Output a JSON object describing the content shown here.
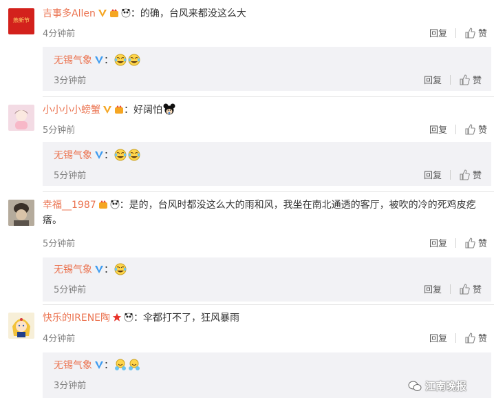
{
  "comments": [
    {
      "user": "吉事多Allen",
      "text": "：的确，台风来都没这么大",
      "time": "4分钟前",
      "reply_label": "回复",
      "like_label": "赞",
      "reply": {
        "user": "无锡气象",
        "text": "：",
        "time": "3分钟前",
        "reply_label": "回复",
        "like_label": "赞",
        "emojis": [
          "laugh-cry-emoji",
          "laugh-cry-emoji"
        ]
      }
    },
    {
      "user": "小小小小螃蟹",
      "text": "：好阔怕",
      "time": "5分钟前",
      "reply_label": "回复",
      "like_label": "赞",
      "reply": {
        "user": "无锡气象",
        "text": "：",
        "time": "5分钟前",
        "reply_label": "回复",
        "like_label": "赞",
        "emojis": [
          "laugh-cry-emoji",
          "laugh-cry-emoji"
        ]
      }
    },
    {
      "user": "幸福__1987",
      "text": "：是的，台风时都没这么大的雨和风，我坐在南北通透的客厅，被吹的冷的死鸡皮疙瘩。",
      "time": "5分钟前",
      "reply_label": "回复",
      "like_label": "赞",
      "reply": {
        "user": "无锡气象",
        "text": "：",
        "time": "5分钟前",
        "reply_label": "回复",
        "like_label": "赞",
        "emojis": [
          "laugh-cry-emoji"
        ]
      }
    },
    {
      "user": "快乐的IRENE陶",
      "text": "：伞都打不了，狂风暴雨",
      "time": "4分钟前",
      "reply_label": "回复",
      "like_label": "赞",
      "reply": {
        "user": "无锡气象",
        "text": "：",
        "time": "3分钟前",
        "reply_label": "回复",
        "like_label": "赞",
        "emojis": [
          "hug-emoji",
          "hug-emoji"
        ]
      }
    }
  ],
  "avatar1_text": "燕新节",
  "watermark": "江南晚报",
  "colors": {
    "username": "#eb7350",
    "reply_bg": "#f2f2f5",
    "vip_orange": "#f5a623",
    "verified_blue": "#3f9cf0"
  }
}
